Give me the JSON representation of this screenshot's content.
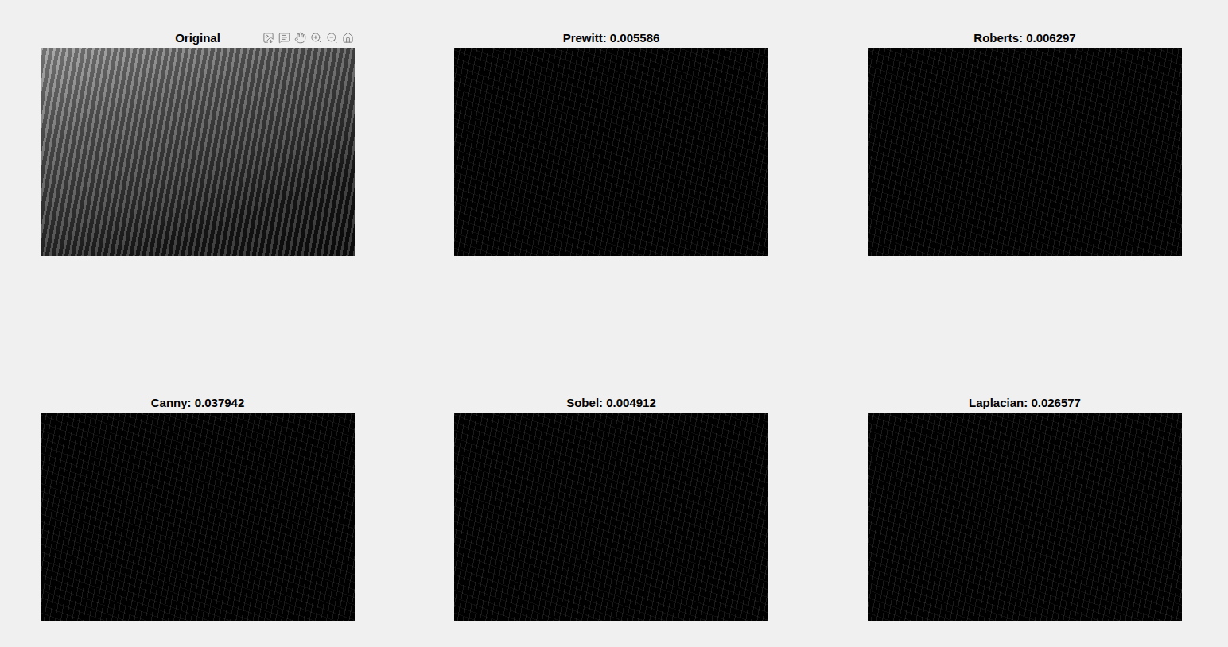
{
  "panels": [
    {
      "title": "Original",
      "kind": "photo",
      "toolbar": true
    },
    {
      "title": "Prewitt: 0.005586",
      "kind": "edges",
      "toolbar": false
    },
    {
      "title": "Roberts: 0.006297",
      "kind": "edges",
      "toolbar": false
    },
    {
      "title": "Canny: 0.037942",
      "kind": "edges",
      "toolbar": false
    },
    {
      "title": "Sobel: 0.004912",
      "kind": "edges",
      "toolbar": false
    },
    {
      "title": "Laplacian: 0.026577",
      "kind": "edges",
      "toolbar": false
    }
  ]
}
